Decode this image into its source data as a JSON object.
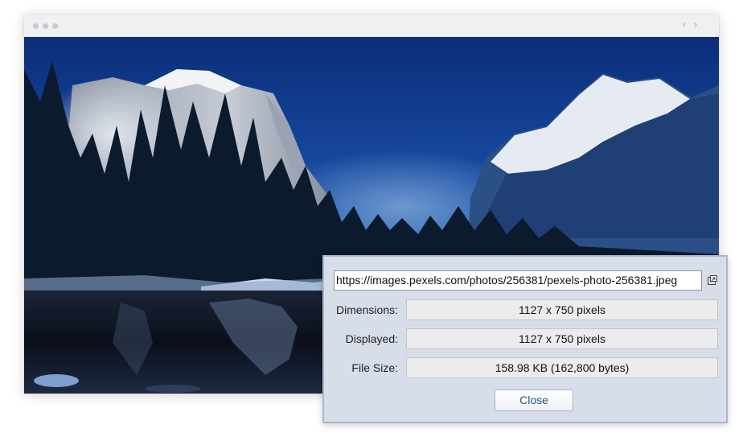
{
  "window": {
    "nav_back": "‹",
    "nav_forward": "›"
  },
  "photo": {
    "icon": "landscape-photo"
  },
  "dialog": {
    "url": "https://images.pexels.com/photos/256381/pexels-photo-256381.jpeg",
    "open_icon": "open-external-icon",
    "rows": [
      {
        "label": "Dimensions:",
        "value": "1127 x 750 pixels"
      },
      {
        "label": "Displayed:",
        "value": "1127 x 750 pixels"
      },
      {
        "label": "File Size:",
        "value": "158.98 KB (162,800 bytes)"
      }
    ],
    "close_label": "Close"
  }
}
